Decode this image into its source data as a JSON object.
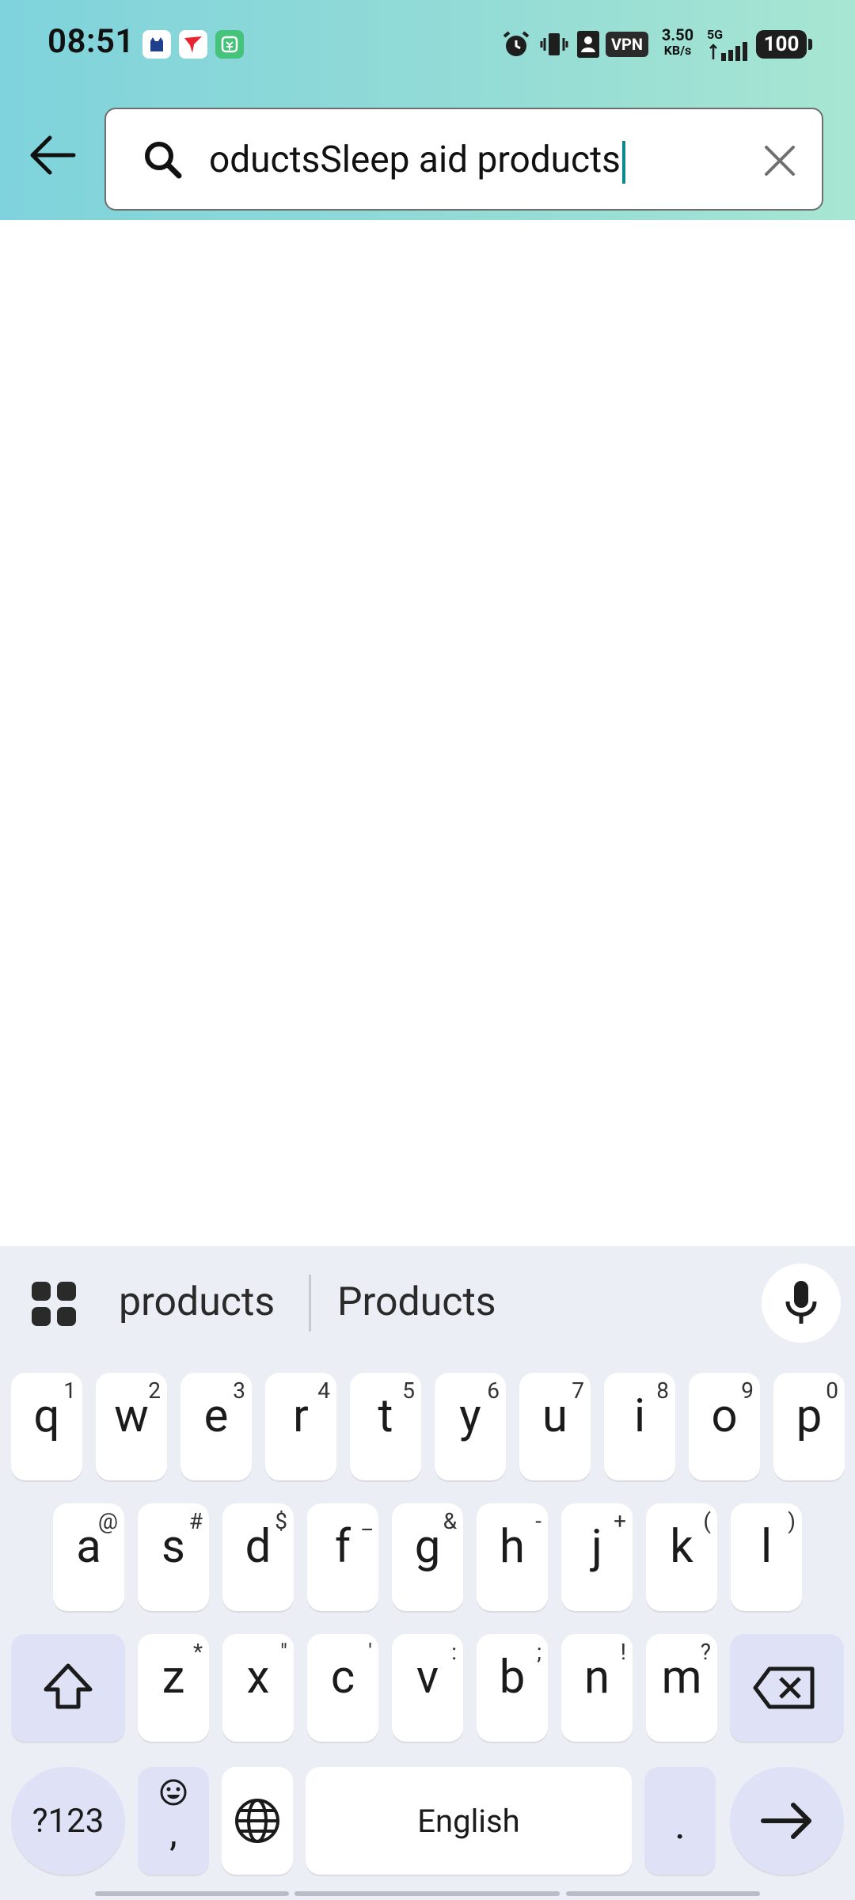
{
  "status_bar": {
    "time": "08:51",
    "network_speed_value": "3.50",
    "network_speed_unit": "KB/s",
    "network_type": "5G",
    "vpn_label": "VPN",
    "battery": "100"
  },
  "search": {
    "query": "oductsSleep aid products"
  },
  "keyboard": {
    "suggestions": [
      "products",
      "Products"
    ],
    "row1": [
      {
        "k": "q",
        "s": "1"
      },
      {
        "k": "w",
        "s": "2"
      },
      {
        "k": "e",
        "s": "3"
      },
      {
        "k": "r",
        "s": "4"
      },
      {
        "k": "t",
        "s": "5"
      },
      {
        "k": "y",
        "s": "6"
      },
      {
        "k": "u",
        "s": "7"
      },
      {
        "k": "i",
        "s": "8"
      },
      {
        "k": "o",
        "s": "9"
      },
      {
        "k": "p",
        "s": "0"
      }
    ],
    "row2": [
      {
        "k": "a",
        "s": "@"
      },
      {
        "k": "s",
        "s": "#"
      },
      {
        "k": "d",
        "s": "$"
      },
      {
        "k": "f",
        "s": "_"
      },
      {
        "k": "g",
        "s": "&"
      },
      {
        "k": "h",
        "s": "-"
      },
      {
        "k": "j",
        "s": "+"
      },
      {
        "k": "k",
        "s": "("
      },
      {
        "k": "l",
        "s": ")"
      }
    ],
    "row3": [
      {
        "k": "z",
        "s": "*"
      },
      {
        "k": "x",
        "s": "\""
      },
      {
        "k": "c",
        "s": "'"
      },
      {
        "k": "v",
        "s": ":"
      },
      {
        "k": "b",
        "s": ";"
      },
      {
        "k": "n",
        "s": "!"
      },
      {
        "k": "m",
        "s": "?"
      }
    ],
    "symbols_key": "?123",
    "comma_key": ",",
    "space_label": "English",
    "period_key": "."
  }
}
